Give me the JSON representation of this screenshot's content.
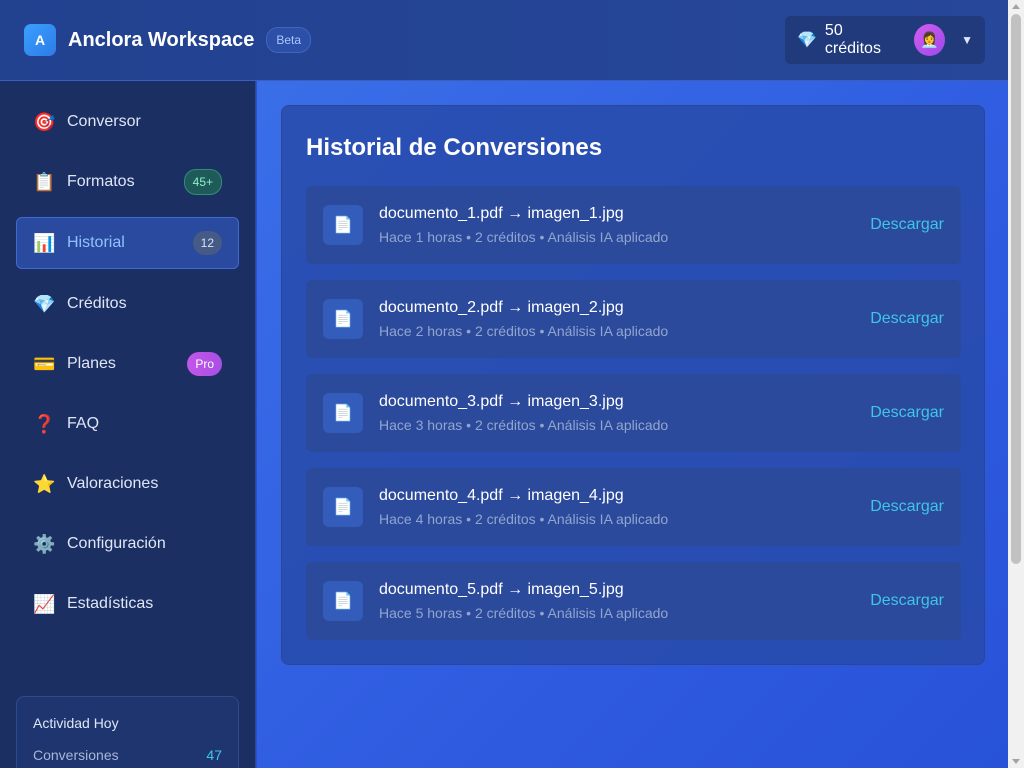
{
  "header": {
    "logo_letter": "A",
    "title": "Anclora Workspace",
    "badge": "Beta",
    "credits": "50 créditos",
    "gem_icon": "💎",
    "avatar_icon": "👩‍💼",
    "chevron": "▼"
  },
  "sidebar": {
    "items": [
      {
        "icon": "🎯",
        "label": "Conversor",
        "badge": ""
      },
      {
        "icon": "📋",
        "label": "Formatos",
        "badge": "45+"
      },
      {
        "icon": "📊",
        "label": "Historial",
        "badge": "12",
        "active": true
      },
      {
        "icon": "💎",
        "label": "Créditos",
        "badge": ""
      },
      {
        "icon": "💳",
        "label": "Planes",
        "badge": "Pro"
      },
      {
        "icon": "❓",
        "label": "FAQ",
        "badge": ""
      },
      {
        "icon": "⭐",
        "label": "Valoraciones",
        "badge": ""
      },
      {
        "icon": "⚙️",
        "label": "Configuración",
        "badge": ""
      },
      {
        "icon": "📈",
        "label": "Estadísticas",
        "badge": ""
      }
    ],
    "activity": {
      "title": "Actividad Hoy",
      "label": "Conversiones",
      "value": "47"
    }
  },
  "main": {
    "title": "Historial de Conversiones",
    "file_icon": "📄",
    "action_label": "Descargar",
    "conversions": [
      {
        "name": "documento_1.pdf → imagen_1.jpg",
        "meta": "Hace 1 horas • 2 créditos • Análisis IA aplicado"
      },
      {
        "name": "documento_2.pdf → imagen_2.jpg",
        "meta": "Hace 2 horas • 2 créditos • Análisis IA aplicado"
      },
      {
        "name": "documento_3.pdf → imagen_3.jpg",
        "meta": "Hace 3 horas • 2 créditos • Análisis IA aplicado"
      },
      {
        "name": "documento_4.pdf → imagen_4.jpg",
        "meta": "Hace 4 horas • 2 créditos • Análisis IA aplicado"
      },
      {
        "name": "documento_5.pdf → imagen_5.jpg",
        "meta": "Hace 5 horas • 2 créditos • Análisis IA aplicado"
      }
    ]
  },
  "colors": {
    "accent": "#3fc5e6",
    "header_bg": "#22418f",
    "sidebar_bg": "#1c2f63",
    "main_bg": "#2f5be0"
  }
}
